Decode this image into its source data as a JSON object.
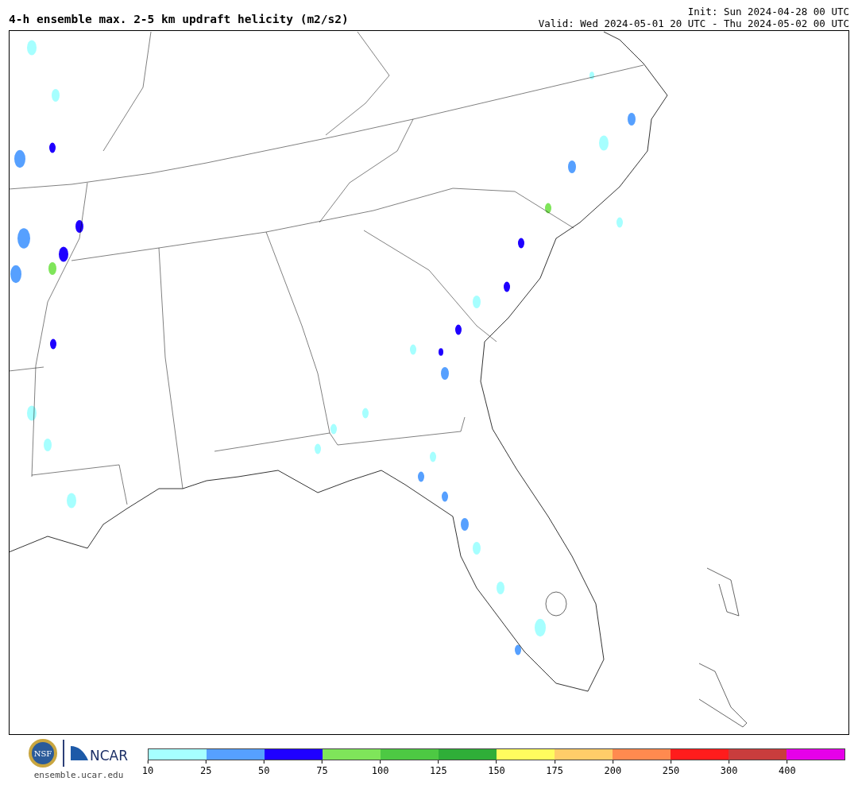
{
  "title": "4-h ensemble max. 2-5 km updraft helicity (m2/s2)",
  "init": "Init: Sun 2024-04-28 00 UTC",
  "valid": "Valid: Wed 2024-05-01 20 UTC - Thu 2024-05-02 00 UTC",
  "logos": {
    "nsf": "NSF",
    "ncar": "NCAR",
    "url": "ensemble.ucar.edu"
  },
  "colorbar": {
    "segments": [
      {
        "color": "#a6ffff"
      },
      {
        "color": "#56a0ff"
      },
      {
        "color": "#1f00ff"
      },
      {
        "color": "#7fe55a"
      },
      {
        "color": "#4dc943"
      },
      {
        "color": "#2fae38"
      },
      {
        "color": "#fffc5e"
      },
      {
        "color": "#ffcd69"
      },
      {
        "color": "#ff8a4f"
      },
      {
        "color": "#ff1c1c"
      },
      {
        "color": "#c93d3d"
      },
      {
        "color": "#e600e9"
      }
    ],
    "ticks": [
      "10",
      "25",
      "50",
      "75",
      "100",
      "125",
      "150",
      "175",
      "200",
      "250",
      "300",
      "400"
    ]
  }
}
